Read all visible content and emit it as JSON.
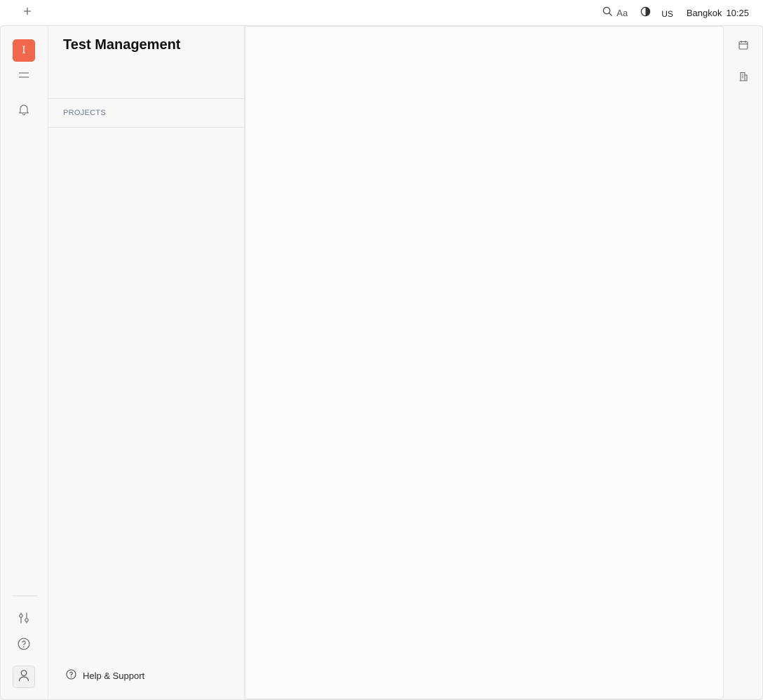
{
  "topbar": {
    "icons": {
      "add": "plus-icon",
      "search": "search-icon",
      "contrast": "contrast-icon"
    },
    "font_label": "Aa",
    "locale": "US",
    "city": "Bangkok",
    "time": "10:25"
  },
  "rail": {
    "logo_letter": "I",
    "logo_color": "#f2674b",
    "icons": [
      "menu-icon",
      "bell-icon",
      "sliders-icon",
      "help-circle-icon",
      "user-icon"
    ]
  },
  "sidebar": {
    "title": "Test Management",
    "section_label": "PROJECTS",
    "help_label": "Help & Support"
  },
  "right_rail": {
    "icons": [
      "calendar-icon",
      "building-icon"
    ]
  }
}
